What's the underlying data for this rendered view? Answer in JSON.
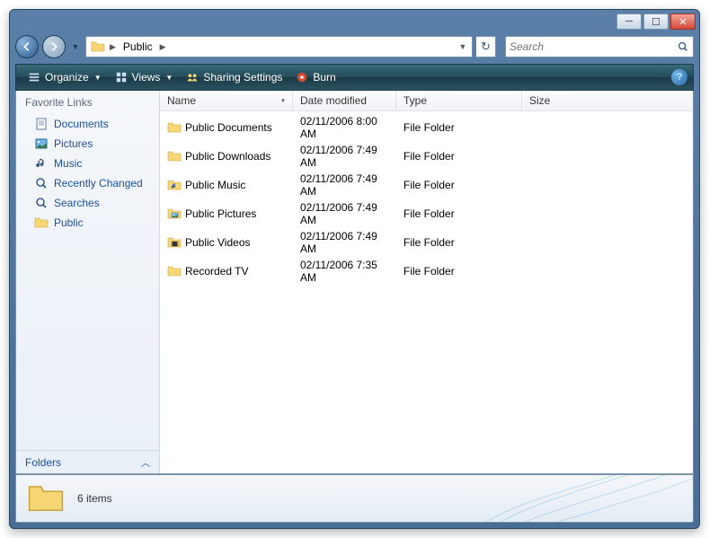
{
  "breadcrumb": {
    "current": "Public"
  },
  "search": {
    "placeholder": "Search"
  },
  "toolbar": {
    "organize": "Organize",
    "views": "Views",
    "sharing": "Sharing Settings",
    "burn": "Burn"
  },
  "sidebar": {
    "heading": "Favorite Links",
    "items": [
      {
        "label": "Documents",
        "icon": "documents"
      },
      {
        "label": "Pictures",
        "icon": "pictures"
      },
      {
        "label": "Music",
        "icon": "music"
      },
      {
        "label": "Recently Changed",
        "icon": "search"
      },
      {
        "label": "Searches",
        "icon": "search"
      },
      {
        "label": "Public",
        "icon": "folder"
      }
    ],
    "folders_label": "Folders"
  },
  "columns": {
    "name": "Name",
    "date": "Date modified",
    "type": "Type",
    "size": "Size"
  },
  "files": [
    {
      "name": "Public Documents",
      "date": "02/11/2006 8:00 AM",
      "type": "File Folder",
      "icon": "folder"
    },
    {
      "name": "Public Downloads",
      "date": "02/11/2006 7:49 AM",
      "type": "File Folder",
      "icon": "folder"
    },
    {
      "name": "Public Music",
      "date": "02/11/2006 7:49 AM",
      "type": "File Folder",
      "icon": "music-folder"
    },
    {
      "name": "Public Pictures",
      "date": "02/11/2006 7:49 AM",
      "type": "File Folder",
      "icon": "picture-folder"
    },
    {
      "name": "Public Videos",
      "date": "02/11/2006 7:49 AM",
      "type": "File Folder",
      "icon": "video-folder"
    },
    {
      "name": "Recorded TV",
      "date": "02/11/2006 7:35 AM",
      "type": "File Folder",
      "icon": "folder"
    }
  ],
  "status": {
    "summary": "6 items"
  }
}
